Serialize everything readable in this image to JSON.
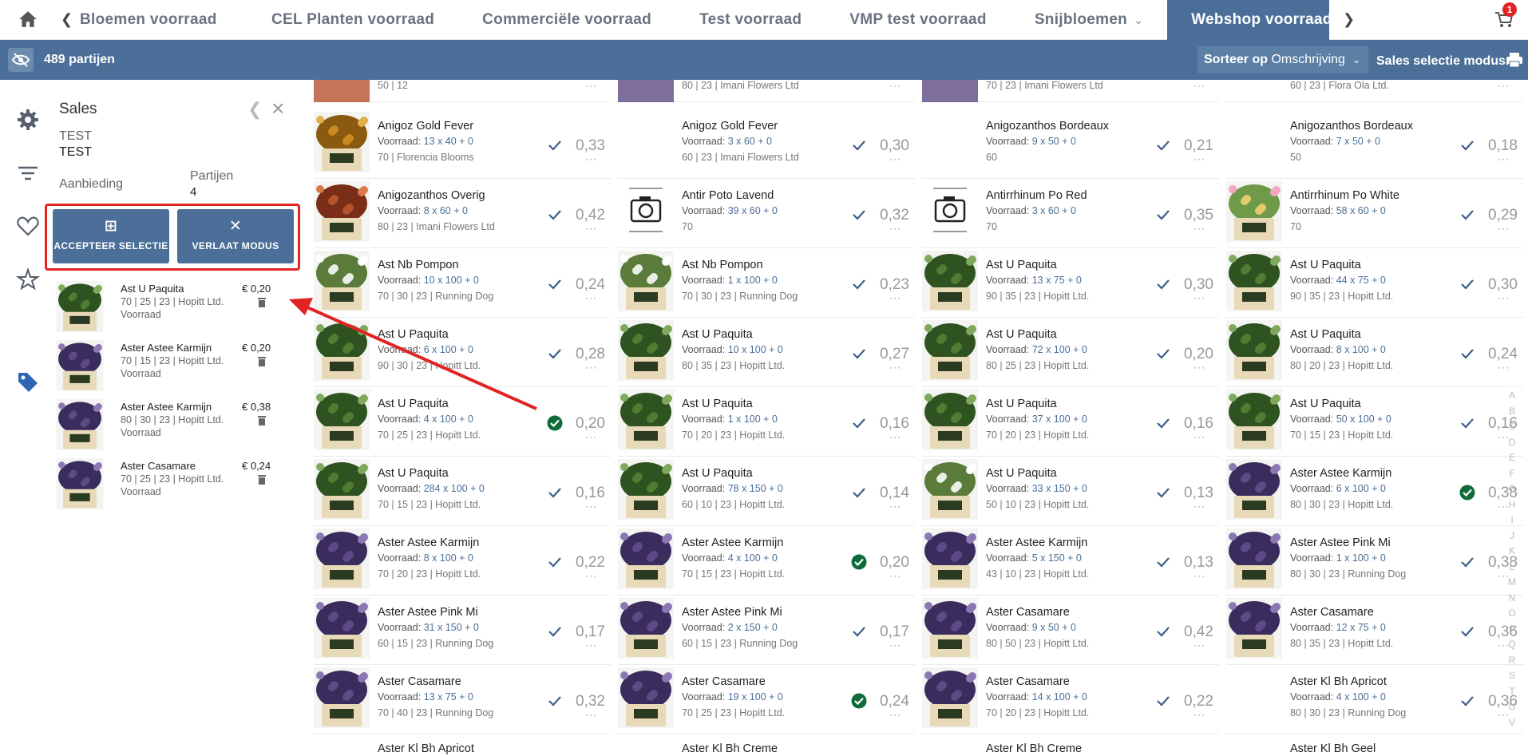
{
  "topbar": {
    "tabs": [
      {
        "label": "Bloemen voorraad"
      },
      {
        "label": "CEL Planten voorraad"
      },
      {
        "label": "Commerciële voorraad"
      },
      {
        "label": "Test voorraad"
      },
      {
        "label": "VMP test voorraad"
      },
      {
        "label": "Snijbloemen"
      },
      {
        "label": "Webshop voorraad"
      }
    ],
    "cart_count": "1"
  },
  "statusbar": {
    "count": "489 partijen",
    "sort_prefix": "Sorteer op",
    "sort_value": "Omschrijving",
    "mode": "Sales selectie modus."
  },
  "panel": {
    "title": "Sales",
    "customer_line1": "TEST",
    "customer_line2": "TEST",
    "aanbieding_label": "Aanbieding",
    "partijen_label": "Partijen",
    "partijen_value": "4",
    "accept_label": "ACCEPTEER SELECTIE",
    "leave_label": "VERLAAT MODUS",
    "items": [
      {
        "name": "Ast U Paquita",
        "meta": "70 | 25 | 23 | Hopitt Ltd.",
        "sub": "Voorraad",
        "price": "€ 0,20"
      },
      {
        "name": "Aster Astee Karmijn",
        "meta": "70 | 15 | 23 | Hopitt Ltd.",
        "sub": "Voorraad",
        "price": "€ 0,20"
      },
      {
        "name": "Aster Astee Karmijn",
        "meta": "80 | 30 | 23 | Hopitt Ltd.",
        "sub": "Voorraad",
        "price": "€ 0,38"
      },
      {
        "name": "Aster Casamare",
        "meta": "70 | 25 | 23 | Hopitt Ltd.",
        "sub": "Voorraad",
        "price": "€ 0,24"
      }
    ]
  },
  "grid": {
    "stock_label": "Voorraad:",
    "dots": "···",
    "top_partial": [
      "50 | 12",
      "80 | 23 | Imani Flowers Ltd",
      "70 | 23 | Imani Flowers Ltd",
      "60 | 23 | Flora Ola Ltd."
    ],
    "columns": [
      [
        {
          "name": "Anigoz Gold Fever",
          "stock": "13 x 40 + 0",
          "meta": "70 | Florencia Blooms",
          "price": "0,33",
          "img": "orange",
          "sel": false
        },
        {
          "name": "Anigozanthos Overig",
          "stock": "8 x 60 + 0",
          "meta": "80 | 23 | Imani Flowers Ltd",
          "price": "0,42",
          "img": "red",
          "sel": false
        },
        {
          "name": "Ast Nb Pompon",
          "stock": "10 x 100 + 0",
          "meta": "70 | 30 | 23 | Running Dog",
          "price": "0,24",
          "img": "white",
          "sel": false
        },
        {
          "name": "Ast U Paquita",
          "stock": "6 x 100 + 0",
          "meta": "90 | 30 | 23 | Hopitt Ltd.",
          "price": "0,28",
          "img": "green",
          "sel": false
        },
        {
          "name": "Ast U Paquita",
          "stock": "4 x 100 + 0",
          "meta": "70 | 25 | 23 | Hopitt Ltd.",
          "price": "0,20",
          "img": "green",
          "sel": true
        },
        {
          "name": "Ast U Paquita",
          "stock": "284 x 100 + 0",
          "meta": "70 | 15 | 23 | Hopitt Ltd.",
          "price": "0,16",
          "img": "green",
          "sel": false
        },
        {
          "name": "Aster Astee Karmijn",
          "stock": "8 x 100 + 0",
          "meta": "70 | 20 | 23 | Hopitt Ltd.",
          "price": "0,22",
          "img": "purple",
          "sel": false
        },
        {
          "name": "Aster Astee Pink Mi",
          "stock": "31 x 150 + 0",
          "meta": "60 | 15 | 23 | Running Dog",
          "price": "0,17",
          "img": "purple",
          "sel": false
        },
        {
          "name": "Aster Casamare",
          "stock": "13 x 75 + 0",
          "meta": "70 | 40 | 23 | Running Dog",
          "price": "0,32",
          "img": "purple",
          "sel": false
        }
      ],
      [
        {
          "name": "Anigoz Gold Fever",
          "stock": "3 x 60 + 0",
          "meta": "60 | 23 | Imani Flowers Ltd",
          "price": "0,30",
          "img": "none",
          "sel": false
        },
        {
          "name": "Antir Poto Lavend",
          "stock": "39 x 60 + 0",
          "meta": "70",
          "price": "0,32",
          "img": "camera",
          "sel": false
        },
        {
          "name": "Ast Nb Pompon",
          "stock": "1 x 100 + 0",
          "meta": "70 | 30 | 23 | Running Dog",
          "price": "0,23",
          "img": "white",
          "sel": false
        },
        {
          "name": "Ast U Paquita",
          "stock": "10 x 100 + 0",
          "meta": "80 | 35 | 23 | Hopitt Ltd.",
          "price": "0,27",
          "img": "green",
          "sel": false
        },
        {
          "name": "Ast U Paquita",
          "stock": "1 x 100 + 0",
          "meta": "70 | 20 | 23 | Hopitt Ltd.",
          "price": "0,16",
          "img": "green",
          "sel": false
        },
        {
          "name": "Ast U Paquita",
          "stock": "78 x 150 + 0",
          "meta": "60 | 10 | 23 | Hopitt Ltd.",
          "price": "0,14",
          "img": "green",
          "sel": false
        },
        {
          "name": "Aster Astee Karmijn",
          "stock": "4 x 100 + 0",
          "meta": "70 | 15 | 23 | Hopitt Ltd.",
          "price": "0,20",
          "img": "purple",
          "sel": true
        },
        {
          "name": "Aster Astee Pink Mi",
          "stock": "2 x 150 + 0",
          "meta": "60 | 15 | 23 | Running Dog",
          "price": "0,17",
          "img": "purple",
          "sel": false
        },
        {
          "name": "Aster Casamare",
          "stock": "19 x 100 + 0",
          "meta": "70 | 25 | 23 | Hopitt Ltd.",
          "price": "0,24",
          "img": "purple",
          "sel": true
        }
      ],
      [
        {
          "name": "Anigozanthos Bordeaux",
          "stock": "9 x 50 + 0",
          "meta": "60",
          "price": "0,21",
          "img": "none",
          "sel": false
        },
        {
          "name": "Antirrhinum Po Red",
          "stock": "3 x 60 + 0",
          "meta": "70",
          "price": "0,35",
          "img": "camera",
          "sel": false
        },
        {
          "name": "Ast U Paquita",
          "stock": "13 x 75 + 0",
          "meta": "90 | 35 | 23 | Hopitt Ltd.",
          "price": "0,30",
          "img": "green",
          "sel": false
        },
        {
          "name": "Ast U Paquita",
          "stock": "72 x 100 + 0",
          "meta": "80 | 25 | 23 | Hopitt Ltd.",
          "price": "0,20",
          "img": "green",
          "sel": false
        },
        {
          "name": "Ast U Paquita",
          "stock": "37 x 100 + 0",
          "meta": "70 | 20 | 23 | Hopitt Ltd.",
          "price": "0,16",
          "img": "green",
          "sel": false
        },
        {
          "name": "Ast U Paquita",
          "stock": "33 x 150 + 0",
          "meta": "50 | 10 | 23 | Hopitt Ltd.",
          "price": "0,13",
          "img": "white",
          "sel": false
        },
        {
          "name": "Aster Astee Karmijn",
          "stock": "5 x 150 + 0",
          "meta": "43 | 10 | 23 | Hopitt Ltd.",
          "price": "0,13",
          "img": "purple",
          "sel": false
        },
        {
          "name": "Aster Casamare",
          "stock": "9 x 50 + 0",
          "meta": "80 | 50 | 23 | Hopitt Ltd.",
          "price": "0,42",
          "img": "purple",
          "sel": false
        },
        {
          "name": "Aster Casamare",
          "stock": "14 x 100 + 0",
          "meta": "70 | 20 | 23 | Hopitt Ltd.",
          "price": "0,22",
          "img": "purple",
          "sel": false
        }
      ],
      [
        {
          "name": "Anigozanthos Bordeaux",
          "stock": "7 x 50 + 0",
          "meta": "50",
          "price": "0,18",
          "img": "none",
          "sel": false
        },
        {
          "name": "Antirrhinum Po White",
          "stock": "58 x 60 + 0",
          "meta": "70",
          "price": "0,29",
          "img": "mixed",
          "sel": false
        },
        {
          "name": "Ast U Paquita",
          "stock": "44 x 75 + 0",
          "meta": "90 | 35 | 23 | Hopitt Ltd.",
          "price": "0,30",
          "img": "green",
          "sel": false
        },
        {
          "name": "Ast U Paquita",
          "stock": "8 x 100 + 0",
          "meta": "80 | 20 | 23 | Hopitt Ltd.",
          "price": "0,24",
          "img": "green",
          "sel": false
        },
        {
          "name": "Ast U Paquita",
          "stock": "50 x 100 + 0",
          "meta": "70 | 15 | 23 | Hopitt Ltd.",
          "price": "0,16",
          "img": "green",
          "sel": false
        },
        {
          "name": "Aster Astee Karmijn",
          "stock": "6 x 100 + 0",
          "meta": "80 | 30 | 23 | Hopitt Ltd.",
          "price": "0,38",
          "img": "purple",
          "sel": true
        },
        {
          "name": "Aster Astee Pink Mi",
          "stock": "1 x 100 + 0",
          "meta": "80 | 30 | 23 | Running Dog",
          "price": "0,38",
          "img": "purple",
          "sel": false
        },
        {
          "name": "Aster Casamare",
          "stock": "12 x 75 + 0",
          "meta": "80 | 35 | 23 | Hopitt Ltd.",
          "price": "0,36",
          "img": "purple",
          "sel": false
        },
        {
          "name": "Aster Kl Bh Apricot",
          "stock": "4 x 100 + 0",
          "meta": "80 | 30 | 23 | Running Dog",
          "price": "0,36",
          "img": "none",
          "sel": false
        }
      ]
    ],
    "bottom_names": [
      "Aster Kl Bh Apricot",
      "Aster Kl Bh Creme",
      "Aster Kl Bh Creme",
      "Aster Kl Bh Geel"
    ]
  },
  "alphabet": [
    "A",
    "B",
    "C",
    "D",
    "E",
    "F",
    "G",
    "H",
    "I",
    "J",
    "K",
    "L",
    "M",
    "N",
    "O",
    "P",
    "Q",
    "R",
    "S",
    "T",
    "U",
    "V"
  ],
  "colors": {
    "primary": "#4b6f98",
    "highlight": "#e02424",
    "check": "#0f6b3a",
    "link": "#4b6f98"
  }
}
